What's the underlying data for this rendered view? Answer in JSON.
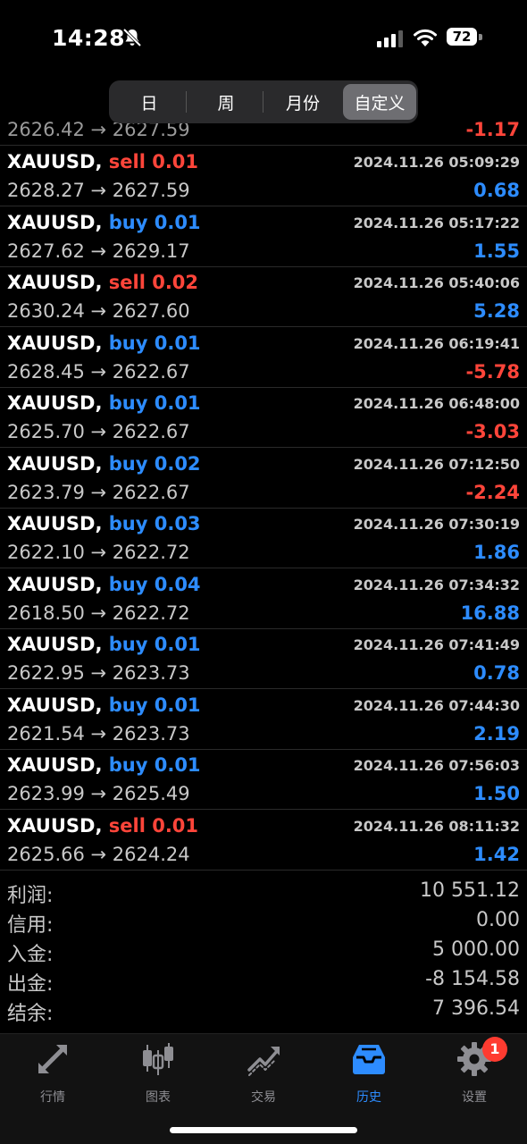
{
  "status": {
    "time": "14:28",
    "battery": "72"
  },
  "periods": [
    "日",
    "周",
    "月份",
    "自定义"
  ],
  "trades": [
    {
      "symbol": "XAUUSD,",
      "side": "sell",
      "volume": "0.01",
      "datetime": "2024.11.26 05:09:29",
      "open": "2628.27",
      "close": "2627.59",
      "profit": "0.68"
    },
    {
      "symbol": "XAUUSD,",
      "side": "buy",
      "volume": "0.01",
      "datetime": "2024.11.26 05:17:22",
      "open": "2627.62",
      "close": "2629.17",
      "profit": "1.55"
    },
    {
      "symbol": "XAUUSD,",
      "side": "sell",
      "volume": "0.02",
      "datetime": "2024.11.26 05:40:06",
      "open": "2630.24",
      "close": "2627.60",
      "profit": "5.28"
    },
    {
      "symbol": "XAUUSD,",
      "side": "buy",
      "volume": "0.01",
      "datetime": "2024.11.26 06:19:41",
      "open": "2628.45",
      "close": "2622.67",
      "profit": "-5.78"
    },
    {
      "symbol": "XAUUSD,",
      "side": "buy",
      "volume": "0.01",
      "datetime": "2024.11.26 06:48:00",
      "open": "2625.70",
      "close": "2622.67",
      "profit": "-3.03"
    },
    {
      "symbol": "XAUUSD,",
      "side": "buy",
      "volume": "0.02",
      "datetime": "2024.11.26 07:12:50",
      "open": "2623.79",
      "close": "2622.67",
      "profit": "-2.24"
    },
    {
      "symbol": "XAUUSD,",
      "side": "buy",
      "volume": "0.03",
      "datetime": "2024.11.26 07:30:19",
      "open": "2622.10",
      "close": "2622.72",
      "profit": "1.86"
    },
    {
      "symbol": "XAUUSD,",
      "side": "buy",
      "volume": "0.04",
      "datetime": "2024.11.26 07:34:32",
      "open": "2618.50",
      "close": "2622.72",
      "profit": "16.88"
    },
    {
      "symbol": "XAUUSD,",
      "side": "buy",
      "volume": "0.01",
      "datetime": "2024.11.26 07:41:49",
      "open": "2622.95",
      "close": "2623.73",
      "profit": "0.78"
    },
    {
      "symbol": "XAUUSD,",
      "side": "buy",
      "volume": "0.01",
      "datetime": "2024.11.26 07:44:30",
      "open": "2621.54",
      "close": "2623.73",
      "profit": "2.19"
    },
    {
      "symbol": "XAUUSD,",
      "side": "buy",
      "volume": "0.01",
      "datetime": "2024.11.26 07:56:03",
      "open": "2623.99",
      "close": "2625.49",
      "profit": "1.50"
    },
    {
      "symbol": "XAUUSD,",
      "side": "sell",
      "volume": "0.01",
      "datetime": "2024.11.26 08:11:32",
      "open": "2625.66",
      "close": "2624.24",
      "profit": "1.42"
    }
  ],
  "summary": [
    {
      "label": "利润:",
      "value": "10 551.12"
    },
    {
      "label": "信用:",
      "value": "0.00"
    },
    {
      "label": "入金:",
      "value": "5 000.00"
    },
    {
      "label": "出金:",
      "value": "-8 154.58"
    },
    {
      "label": "结余:",
      "value": "7 396.54"
    }
  ],
  "tabs": [
    {
      "label": "行情",
      "icon": "quotes-arrows-icon"
    },
    {
      "label": "图表",
      "icon": "candlestick-chart-icon"
    },
    {
      "label": "交易",
      "icon": "trade-trend-icon"
    },
    {
      "label": "历史",
      "icon": "history-inbox-icon"
    },
    {
      "label": "设置",
      "icon": "gear-icon"
    }
  ],
  "settings_badge": "1",
  "colors": {
    "buy": "#2d8cff",
    "sell": "#ff453a",
    "active_tab": "#2d8cff"
  }
}
